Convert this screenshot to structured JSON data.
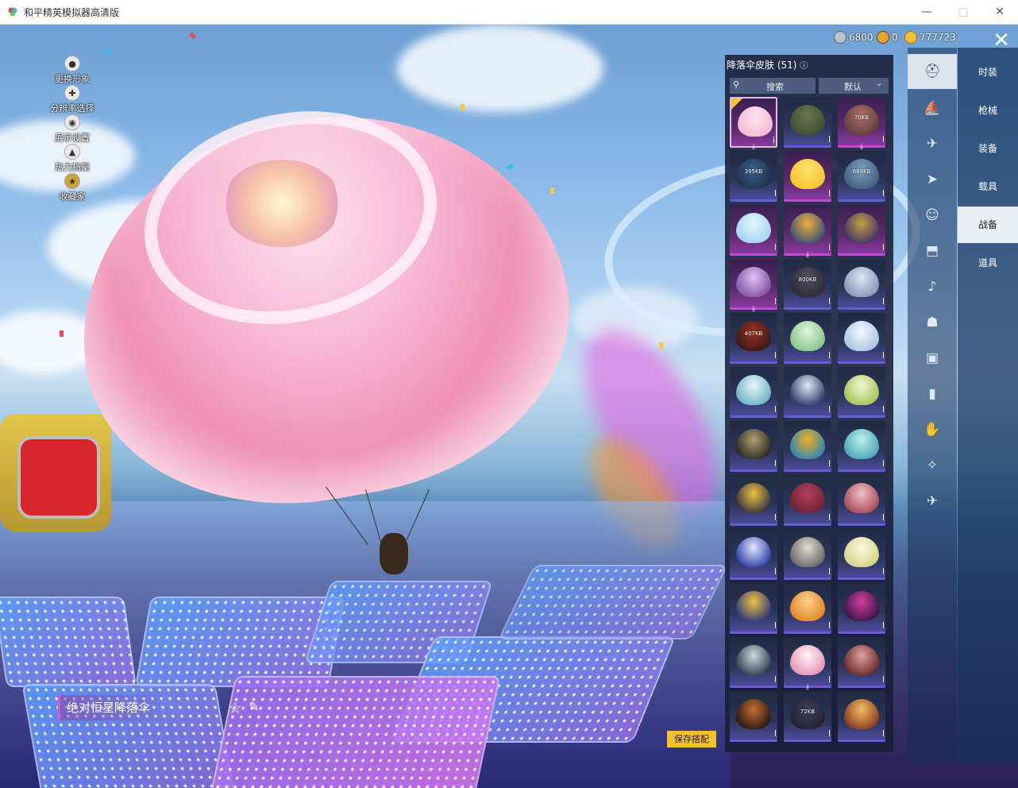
{
  "window": {
    "title": "和平精英模拟器高清版",
    "minimize_icon": "minimize-icon",
    "maximize_icon": "maximize-icon",
    "close_icon": "close-icon"
  },
  "currency": [
    {
      "name": "silver-coin-icon",
      "value": "6800",
      "color": "#b8c2cc"
    },
    {
      "name": "gold-token-icon",
      "value": "0",
      "color": "#e0a820"
    },
    {
      "name": "diamond-coin-icon",
      "value": "777723",
      "color": "#f0c030"
    }
  ],
  "side_menu": [
    {
      "label": "更换形象",
      "icon": "avatar-icon"
    },
    {
      "label": "分辨率选择",
      "icon": "resolution-icon"
    },
    {
      "label": "展示设置",
      "icon": "eye-icon"
    },
    {
      "label": "热力挡案",
      "icon": "fire-icon"
    },
    {
      "label": "收藏家",
      "icon": "collector-icon"
    }
  ],
  "panel": {
    "title": "降落伞皮肤 (51)",
    "info_icon": "info-icon",
    "search_icon": "search-icon",
    "search_label": "搜索",
    "sort_label": "默认",
    "sort_icon": "chevron-down-icon"
  },
  "skins": [
    {
      "rarity": "purple",
      "colors": [
        "#f7b6d2",
        "#fbe3ef"
      ],
      "selected": true,
      "download": ""
    },
    {
      "rarity": "blue",
      "colors": [
        "#3d4a2e",
        "#6b7550"
      ],
      "selected": false,
      "download": ""
    },
    {
      "rarity": "purple",
      "colors": [
        "#5a3a3a",
        "#b0706a"
      ],
      "selected": false,
      "download": "70KB"
    },
    {
      "rarity": "blue",
      "colors": [
        "#223048",
        "#3b5d8c"
      ],
      "selected": false,
      "download": "395KB"
    },
    {
      "rarity": "purple",
      "colors": [
        "#f6c02a",
        "#ffe36e"
      ],
      "selected": false,
      "download": ""
    },
    {
      "rarity": "blue",
      "colors": [
        "#3a5a78",
        "#7fa0c0"
      ],
      "selected": false,
      "download": "689KB"
    },
    {
      "rarity": "purple",
      "colors": [
        "#9ad0f0",
        "#e8f6ff"
      ],
      "selected": false,
      "download": ""
    },
    {
      "rarity": "purple",
      "colors": [
        "#2a4a7a",
        "#f0b040"
      ],
      "selected": false,
      "download": ""
    },
    {
      "rarity": "purple",
      "colors": [
        "#3a2a6a",
        "#c0a040"
      ],
      "selected": false,
      "download": ""
    },
    {
      "rarity": "purple",
      "colors": [
        "#7a4aa0",
        "#e0c0f0"
      ],
      "selected": false,
      "download": ""
    },
    {
      "rarity": "blue",
      "colors": [
        "#2a2a30",
        "#505060"
      ],
      "selected": false,
      "download": "800KB"
    },
    {
      "rarity": "blue",
      "colors": [
        "#8090b0",
        "#dfe6f5"
      ],
      "selected": false,
      "download": ""
    },
    {
      "rarity": "blue",
      "colors": [
        "#301818",
        "#a03020"
      ],
      "selected": false,
      "download": "407KB"
    },
    {
      "rarity": "blue",
      "colors": [
        "#80c080",
        "#e0f5e0"
      ],
      "selected": false,
      "download": ""
    },
    {
      "rarity": "blue",
      "colors": [
        "#a0c0e0",
        "#f5f8ff"
      ],
      "selected": false,
      "download": ""
    },
    {
      "rarity": "blue",
      "colors": [
        "#60b0c0",
        "#e8f5f8"
      ],
      "selected": false,
      "download": ""
    },
    {
      "rarity": "blue",
      "colors": [
        "#203060",
        "#e0e8f5"
      ],
      "selected": false,
      "download": ""
    },
    {
      "rarity": "blue",
      "colors": [
        "#a0c050",
        "#f0f5d0"
      ],
      "selected": false,
      "download": ""
    },
    {
      "rarity": "blue",
      "colors": [
        "#202020",
        "#b0a070"
      ],
      "selected": false,
      "download": ""
    },
    {
      "rarity": "blue",
      "colors": [
        "#2080c0",
        "#f0b020"
      ],
      "selected": false,
      "download": ""
    },
    {
      "rarity": "blue",
      "colors": [
        "#40a0b0",
        "#c0f0f0"
      ],
      "selected": false,
      "download": ""
    },
    {
      "rarity": "blue",
      "colors": [
        "#202840",
        "#f0c040"
      ],
      "selected": false,
      "download": ""
    },
    {
      "rarity": "blue",
      "colors": [
        "#6a2030",
        "#b04060"
      ],
      "selected": false,
      "download": ""
    },
    {
      "rarity": "blue",
      "colors": [
        "#a04050",
        "#f0c0c8"
      ],
      "selected": false,
      "download": ""
    },
    {
      "rarity": "blue",
      "colors": [
        "#2030a0",
        "#e0e8ff"
      ],
      "selected": false,
      "download": ""
    },
    {
      "rarity": "blue",
      "colors": [
        "#606060",
        "#e0dcd0"
      ],
      "selected": false,
      "download": ""
    },
    {
      "rarity": "blue",
      "colors": [
        "#d0d080",
        "#fafae0"
      ],
      "selected": false,
      "download": ""
    },
    {
      "rarity": "blue",
      "colors": [
        "#203080",
        "#f0c040"
      ],
      "selected": false,
      "download": ""
    },
    {
      "rarity": "blue",
      "colors": [
        "#e08020",
        "#f8d090"
      ],
      "selected": false,
      "download": ""
    },
    {
      "rarity": "blue",
      "colors": [
        "#301040",
        "#d040a0"
      ],
      "selected": false,
      "download": ""
    },
    {
      "rarity": "blue",
      "colors": [
        "#203040",
        "#d0d8e0"
      ],
      "selected": false,
      "download": ""
    },
    {
      "rarity": "blue",
      "colors": [
        "#e090b0",
        "#fff0f5"
      ],
      "selected": false,
      "download": ""
    },
    {
      "rarity": "blue",
      "colors": [
        "#602020",
        "#e0a0a0"
      ],
      "selected": false,
      "download": ""
    },
    {
      "rarity": "blue",
      "colors": [
        "#201010",
        "#c07030"
      ],
      "selected": false,
      "download": ""
    },
    {
      "rarity": "blue",
      "colors": [
        "#202030",
        "#404058"
      ],
      "selected": false,
      "download": "72KB"
    },
    {
      "rarity": "blue",
      "colors": [
        "#803020",
        "#f0c060"
      ],
      "selected": false,
      "download": ""
    }
  ],
  "category_icons": [
    "helmet-icon",
    "boat-icon",
    "drone-icon",
    "glider-icon",
    "emote-icon",
    "backpack-icon",
    "speaker-icon",
    "robot-icon",
    "photo-icon",
    "extinguisher-icon",
    "hand-icon",
    "wand-icon",
    "plane-icon"
  ],
  "tabs": [
    {
      "label": "时装",
      "active": false
    },
    {
      "label": "枪械",
      "active": false
    },
    {
      "label": "装备",
      "active": false
    },
    {
      "label": "载具",
      "active": false
    },
    {
      "label": "战备",
      "active": true
    },
    {
      "label": "道具",
      "active": false
    }
  ],
  "main": {
    "item_name": "绝对恒星降落伞",
    "favorite_icon": "star-icon",
    "edit_icon": "edit-icon",
    "save_label": "保存搭配",
    "close_icon": "close-x-icon"
  }
}
